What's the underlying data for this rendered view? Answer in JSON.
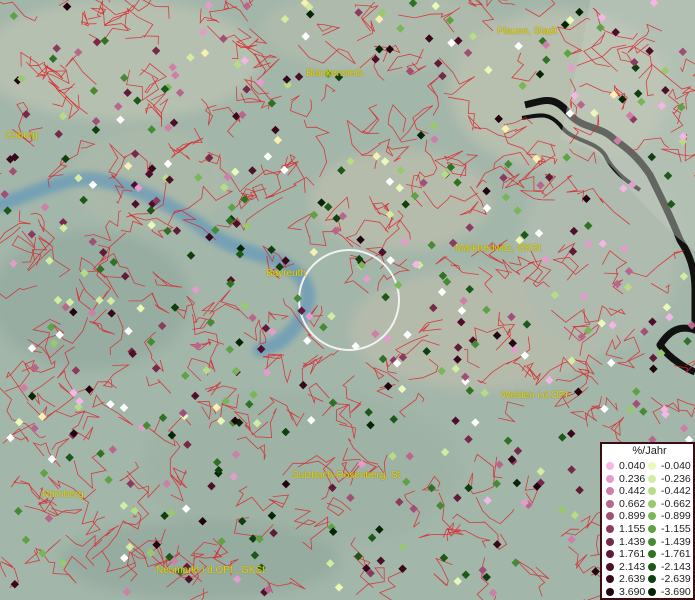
{
  "map": {
    "cities": [
      {
        "name": "Plauen, Stadt",
        "id": "plauen"
      },
      {
        "name": "Blankenstein",
        "id": "blankenstein"
      },
      {
        "name": "Coburg",
        "id": "coburg"
      },
      {
        "name": "Marktredwitz, GKSt",
        "id": "marktredwitz"
      },
      {
        "name": "Bayreuth",
        "id": "bayreuth"
      },
      {
        "name": "Weiden i.d.OPf.",
        "id": "weiden"
      },
      {
        "name": "Sulzbach-Rosenberg, St",
        "id": "sulzbach"
      },
      {
        "name": "Nürnberg",
        "id": "nuernberg"
      },
      {
        "name": "Neumarkt i.d.OPf., GKSt",
        "id": "neumarkt"
      }
    ]
  },
  "legend": {
    "title": "%/Jahr",
    "positive": [
      {
        "value": "0.040",
        "color": "#f4b6e6"
      },
      {
        "value": "0.236",
        "color": "#e59bcc"
      },
      {
        "value": "0.442",
        "color": "#cf7ea9"
      },
      {
        "value": "0.662",
        "color": "#b9668f"
      },
      {
        "value": "0.899",
        "color": "#a14f77"
      },
      {
        "value": "1.155",
        "color": "#8c3b60"
      },
      {
        "value": "1.439",
        "color": "#77294c"
      },
      {
        "value": "1.761",
        "color": "#621a39"
      },
      {
        "value": "2.143",
        "color": "#4d0f29"
      },
      {
        "value": "2.639",
        "color": "#39081b"
      },
      {
        "value": "3.690",
        "color": "#230310"
      }
    ],
    "negative": [
      {
        "value": "-0.040",
        "color": "#eaf8b8"
      },
      {
        "value": "-0.236",
        "color": "#d3eca0"
      },
      {
        "value": "-0.442",
        "color": "#b7dc86"
      },
      {
        "value": "-0.662",
        "color": "#98c96c"
      },
      {
        "value": "-0.899",
        "color": "#79b657"
      },
      {
        "value": "-1.155",
        "color": "#5ea244"
      },
      {
        "value": "-1.439",
        "color": "#468b33"
      },
      {
        "value": "-1.761",
        "color": "#2f7224"
      },
      {
        "value": "-2.143",
        "color": "#1c5817"
      },
      {
        "value": "-2.639",
        "color": "#0f3f0c"
      },
      {
        "value": "-3.690",
        "color": "#062505"
      }
    ]
  }
}
